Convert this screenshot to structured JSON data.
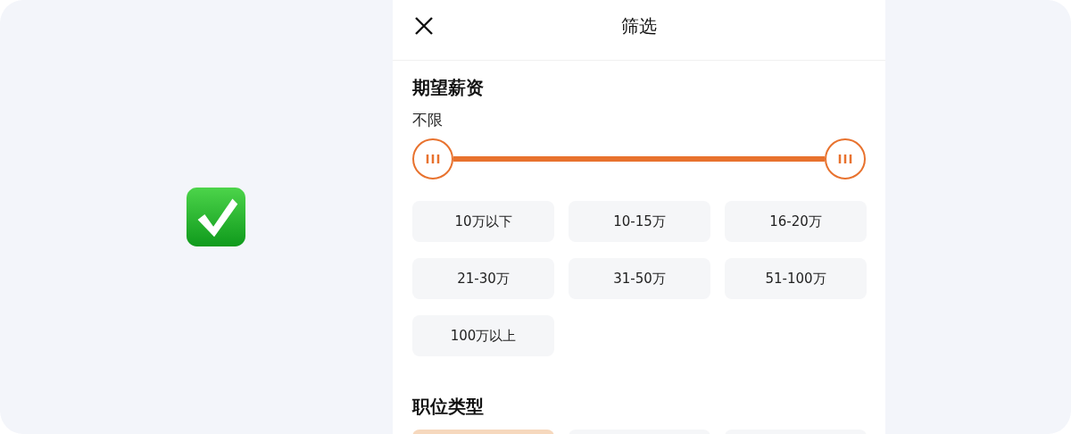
{
  "header": {
    "title": "筛选"
  },
  "salary": {
    "title": "期望薪资",
    "range_label": "不限",
    "options": [
      {
        "label": "10万以下",
        "selected": false
      },
      {
        "label": "10-15万",
        "selected": false
      },
      {
        "label": "16-20万",
        "selected": false
      },
      {
        "label": "21-30万",
        "selected": false
      },
      {
        "label": "31-50万",
        "selected": false
      },
      {
        "label": "51-100万",
        "selected": false
      },
      {
        "label": "100万以上",
        "selected": false
      }
    ]
  },
  "job_type": {
    "title": "职位类型",
    "options": [
      {
        "selected": true
      },
      {
        "selected": false
      },
      {
        "selected": false
      }
    ]
  }
}
